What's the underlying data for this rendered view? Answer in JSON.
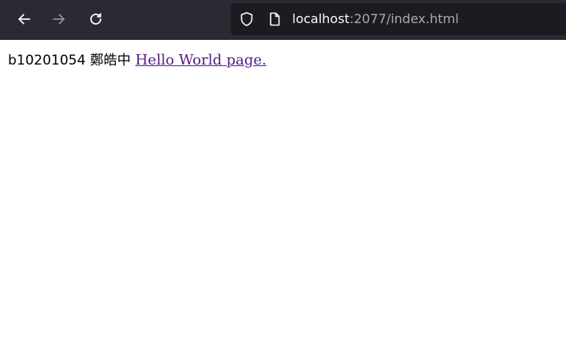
{
  "browser": {
    "url_host": "localhost",
    "url_rest": ":2077/index.html",
    "icons": {
      "back": "back-arrow-icon",
      "forward": "forward-arrow-icon",
      "reload": "reload-icon",
      "shield": "shield-icon",
      "page": "page-icon"
    },
    "colors": {
      "toolbar": "#2b2a33",
      "urlbar": "#1c1b22",
      "icon_active": "#fbfbfe",
      "icon_disabled": "#8f8f9d"
    }
  },
  "page": {
    "student_text": "b10201054 鄭皓中",
    "link_text": "Hello World page.",
    "link_color": "#551a8b"
  }
}
